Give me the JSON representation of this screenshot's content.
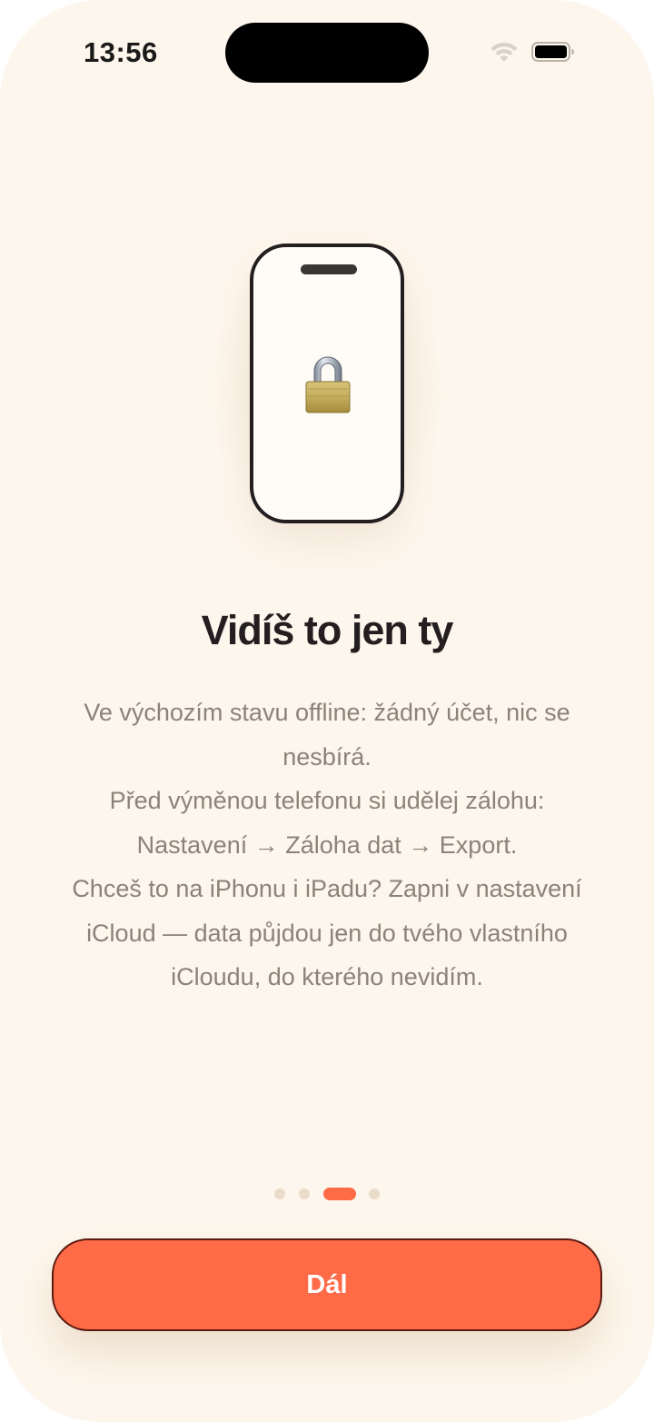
{
  "status_bar": {
    "time": "13:56",
    "wifi_icon": "wifi-icon",
    "battery_icon": "battery-icon"
  },
  "illustration": {
    "device_icon": "phone-outline-icon",
    "lock_icon": "lock-icon"
  },
  "onboarding": {
    "title": "Vidíš to jen ty",
    "lines": [
      "Ve výchozím stavu offline: žádný účet, nic se",
      "nesbírá.",
      "Před výměnou telefonu si udělej zálohu:",
      "Nastavení → Záloha dat → Export.",
      "Chceš to na iPhonu i iPadu? Zapni v nastavení",
      "iCloud — data půjdou jen do tvého vlastního",
      "iCloudu, do kterého nevidím."
    ]
  },
  "pager": {
    "page_count": 4,
    "current_page": 3
  },
  "actions": {
    "next_label": "Dál"
  },
  "colors": {
    "background": "#fdf6ec",
    "accent": "#ff6a47",
    "title": "#231f20",
    "body_text": "#8c8279",
    "dot_inactive": "#eadcc9"
  }
}
